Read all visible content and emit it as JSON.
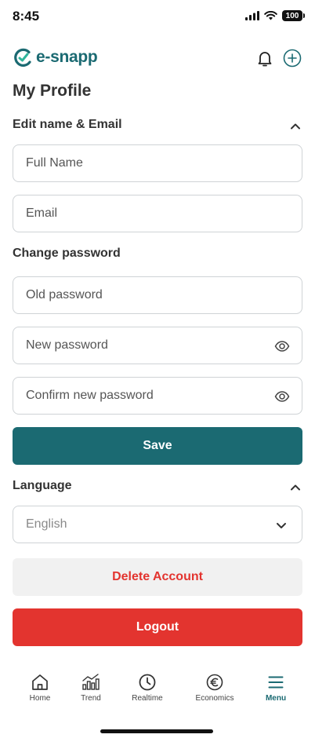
{
  "status_bar": {
    "time": "8:45",
    "battery": "100"
  },
  "header": {
    "logo_text": "e-snapp",
    "icons": [
      "bell-icon",
      "plus-circle-icon"
    ]
  },
  "page_title": "My Profile",
  "sections": {
    "name_email": {
      "title": "Edit name & Email",
      "full_name": {
        "placeholder": "Full Name",
        "value": ""
      },
      "email": {
        "placeholder": "Email",
        "value": ""
      }
    },
    "password": {
      "title": "Change password",
      "old": {
        "placeholder": "Old password",
        "value": ""
      },
      "new": {
        "placeholder": "New password",
        "value": ""
      },
      "confirm": {
        "placeholder": "Confirm new password",
        "value": ""
      }
    },
    "language": {
      "title": "Language",
      "selected": "English"
    }
  },
  "buttons": {
    "save": "Save",
    "delete_account": "Delete Account",
    "logout": "Logout"
  },
  "tabs": [
    {
      "label": "Home",
      "icon": "home-icon"
    },
    {
      "label": "Trend",
      "icon": "chart-icon"
    },
    {
      "label": "Realtime",
      "icon": "clock-icon"
    },
    {
      "label": "Economics",
      "icon": "euro-icon"
    },
    {
      "label": "Menu",
      "icon": "menu-icon",
      "active": true
    }
  ],
  "colors": {
    "brand": "#1b6a72",
    "danger": "#e3342f",
    "border": "#cfd3d6",
    "muted_bg": "#f1f1f1"
  }
}
